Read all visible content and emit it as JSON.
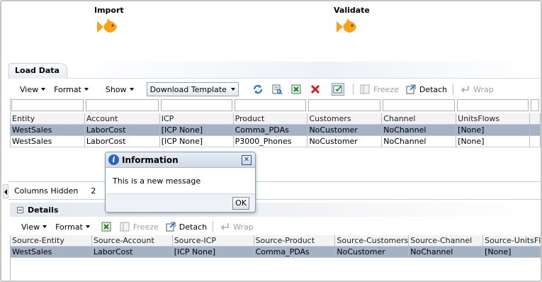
{
  "train": {
    "steps": [
      {
        "label": "Import"
      },
      {
        "label": "Validate"
      }
    ]
  },
  "load_data": {
    "tab_label": "Load Data",
    "toolbar": {
      "view": "View",
      "format": "Format",
      "show": "Show",
      "template_select": "Download Template",
      "freeze": "Freeze",
      "detach": "Detach",
      "wrap": "Wrap"
    },
    "columns": [
      "Entity",
      "Account",
      "ICP",
      "Product",
      "Customers",
      "Channel",
      "UnitsFlows"
    ],
    "rows": [
      [
        "WestSales",
        "LaborCost",
        "[ICP None]",
        "Comma_PDAs",
        "NoCustomer",
        "NoChannel",
        "[None]"
      ],
      [
        "WestSales",
        "LaborCost",
        "[ICP None]",
        "P3000_Phones",
        "NoCustomer",
        "NoChannel",
        "[None]"
      ]
    ],
    "columns_hidden_label": "Columns Hidden",
    "columns_hidden_count": "2"
  },
  "details": {
    "title": "Details",
    "toolbar": {
      "view": "View",
      "format": "Format",
      "freeze": "Freeze",
      "detach": "Detach",
      "wrap": "Wrap"
    },
    "columns": [
      "Source-Entity",
      "Source-Account",
      "Source-ICP",
      "Source-Product",
      "Source-Customers",
      "Source-Channel",
      "Source-UnitsFlo"
    ],
    "rows": [
      [
        "WestSales",
        "LaborCost",
        "[ICP None]",
        "Comma_PDAs",
        "NoCustomer",
        "NoChannel",
        "[None]"
      ]
    ]
  },
  "dialog": {
    "title": "Information",
    "message": "This is a new message",
    "ok_label": "OK"
  },
  "colors": {
    "selected_row": "#a5b1c5",
    "train_icon": "#f7a21b",
    "info_icon": "#2f64b8"
  }
}
